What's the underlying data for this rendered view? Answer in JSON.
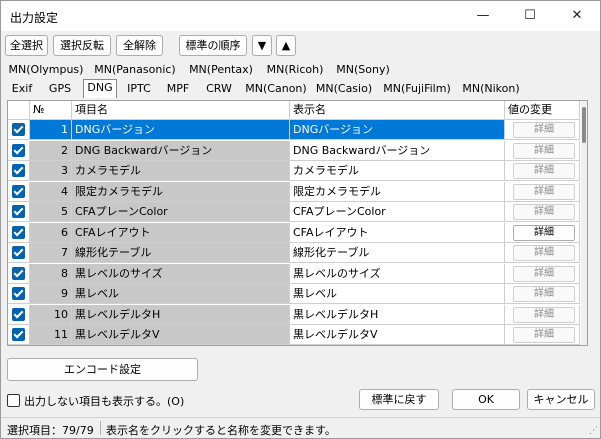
{
  "window": {
    "title": "出力設定",
    "minimize": "—",
    "maximize": "☐",
    "close": "✕"
  },
  "toolbar": {
    "select_all": "全選択",
    "invert": "選択反転",
    "deselect_all": "全解除",
    "default_order": "標準の順序",
    "move_down": "▼",
    "move_up": "▲"
  },
  "tabs_row1": [
    "MN(Olympus)",
    "MN(Panasonic)",
    "MN(Pentax)",
    "MN(Ricoh)",
    "MN(Sony)"
  ],
  "tabs_row2": [
    "Exif",
    "GPS",
    "DNG",
    "IPTC",
    "MPF",
    "CRW",
    "MN(Canon)",
    "MN(Casio)",
    "MN(FujiFilm)",
    "MN(Nikon)"
  ],
  "selected_tab": "DNG",
  "table": {
    "headers": {
      "no": "№",
      "name": "項目名",
      "display": "表示名",
      "action": "値の変更"
    },
    "rows": [
      {
        "no": "1",
        "name": "DNGバージョン",
        "display": "DNGバージョン",
        "action": "詳細",
        "enabled": false,
        "selected": true
      },
      {
        "no": "2",
        "name": "DNG Backwardバージョン",
        "display": "DNG Backwardバージョン",
        "action": "詳細",
        "enabled": false,
        "selected": false
      },
      {
        "no": "3",
        "name": "カメラモデル",
        "display": "カメラモデル",
        "action": "詳細",
        "enabled": false,
        "selected": false
      },
      {
        "no": "4",
        "name": "限定カメラモデル",
        "display": "限定カメラモデル",
        "action": "詳細",
        "enabled": false,
        "selected": false
      },
      {
        "no": "5",
        "name": "CFAプレーンColor",
        "display": "CFAプレーンColor",
        "action": "詳細",
        "enabled": false,
        "selected": false
      },
      {
        "no": "6",
        "name": "CFAレイアウト",
        "display": "CFAレイアウト",
        "action": "詳細",
        "enabled": true,
        "selected": false
      },
      {
        "no": "7",
        "name": "線形化テーブル",
        "display": "線形化テーブル",
        "action": "詳細",
        "enabled": false,
        "selected": false
      },
      {
        "no": "8",
        "name": "黒レベルのサイズ",
        "display": "黒レベルのサイズ",
        "action": "詳細",
        "enabled": false,
        "selected": false
      },
      {
        "no": "9",
        "name": "黒レベル",
        "display": "黒レベル",
        "action": "詳細",
        "enabled": false,
        "selected": false
      },
      {
        "no": "10",
        "name": "黒レベルデルタH",
        "display": "黒レベルデルタH",
        "action": "詳細",
        "enabled": false,
        "selected": false
      },
      {
        "no": "11",
        "name": "黒レベルデルタV",
        "display": "黒レベルデルタV",
        "action": "詳細",
        "enabled": false,
        "selected": false
      }
    ]
  },
  "encode_button": "エンコード設定",
  "show_hidden_label": "出力しない項目も表示する。(O)",
  "reset_button": "標準に戻す",
  "ok_button": "OK",
  "cancel_button": "キャンセル",
  "status": {
    "selection": "選択項目：79/79",
    "hint": "表示名をクリックすると名称を変更できます。"
  },
  "colors": {
    "selection": "#0078d7",
    "checkbox": "#0063b1",
    "readonly_cell": "#c8c8c8"
  }
}
